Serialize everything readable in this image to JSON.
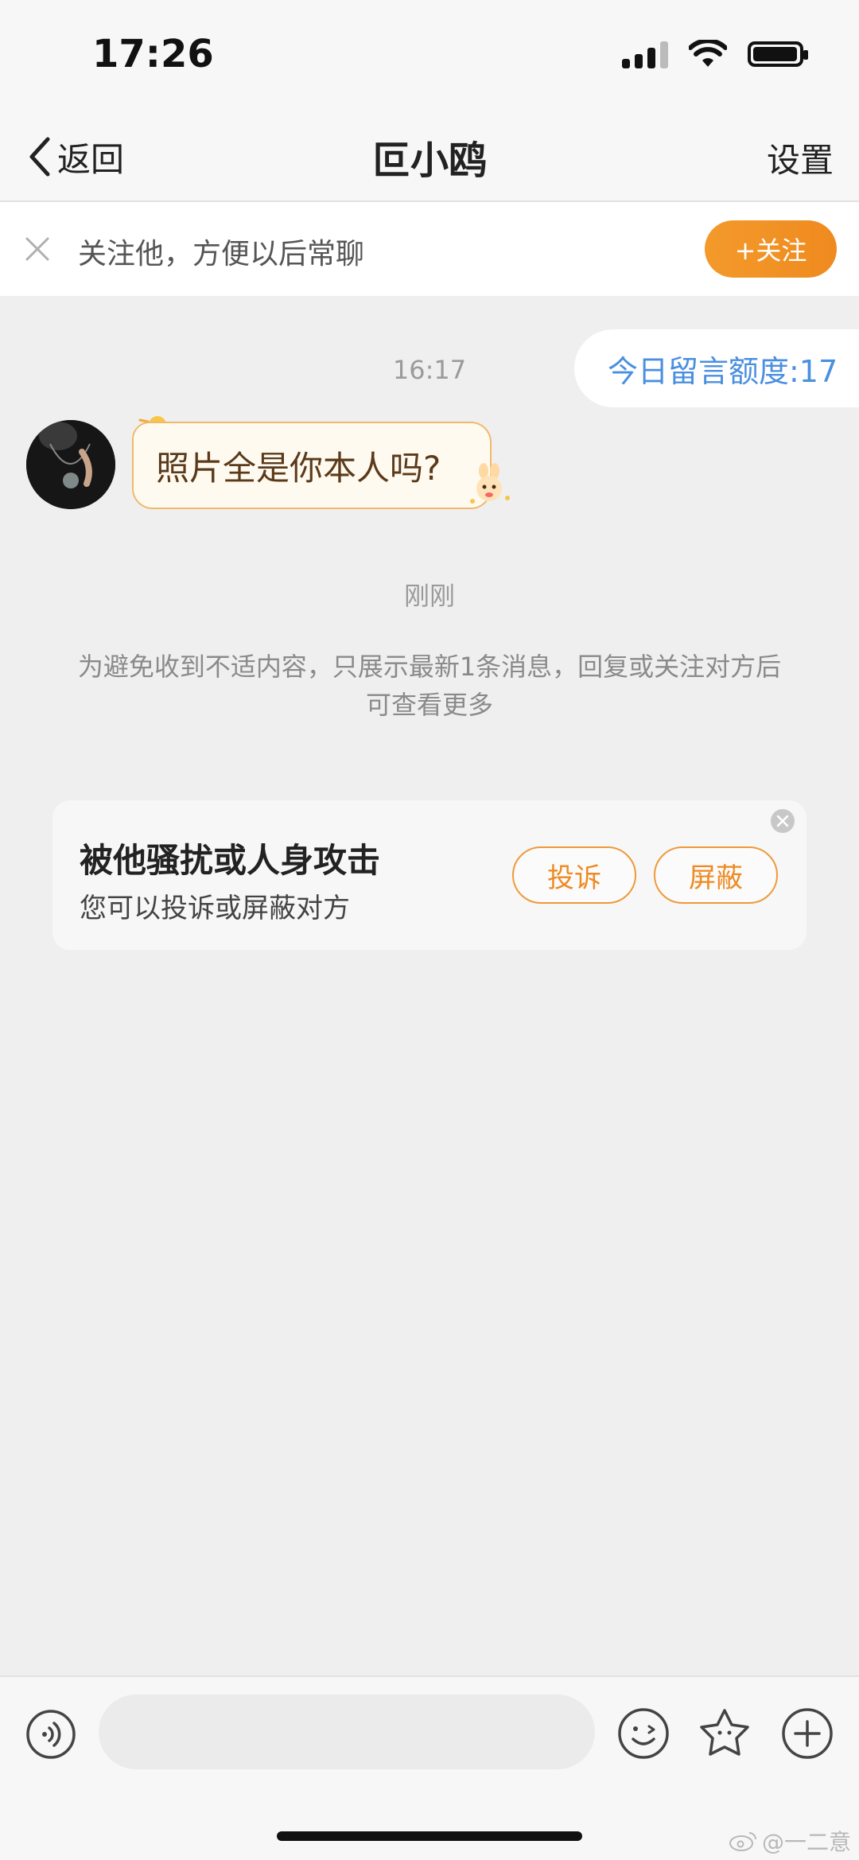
{
  "status_bar": {
    "time": "17:26",
    "icons": [
      "signal-icon",
      "wifi-icon",
      "battery-icon"
    ]
  },
  "nav": {
    "back_label": "返回",
    "title": "叵小鸥",
    "settings_label": "设置"
  },
  "follow_banner": {
    "text": "关注他，方便以后常聊",
    "button_label": "+关注"
  },
  "chat": {
    "quota_text": "今日留言额度:17",
    "time_1": "16:17",
    "message_text": "照片全是你本人吗?",
    "time_2": "刚刚",
    "notice": "为避免收到不适内容，只展示最新1条消息，回复或关注对方后可查看更多"
  },
  "harass_card": {
    "title": "被他骚扰或人身攻击",
    "subtitle": "您可以投诉或屏蔽对方",
    "report_label": "投诉",
    "block_label": "屏蔽"
  },
  "input_bar": {
    "placeholder": "",
    "icons": [
      "voice-icon",
      "emoji-icon",
      "sticker-icon",
      "plus-icon"
    ]
  },
  "watermark": "@一二意",
  "colors": {
    "accent_orange": "#ef8a1f",
    "link_blue": "#4a8fe0",
    "background": "#efefef"
  }
}
